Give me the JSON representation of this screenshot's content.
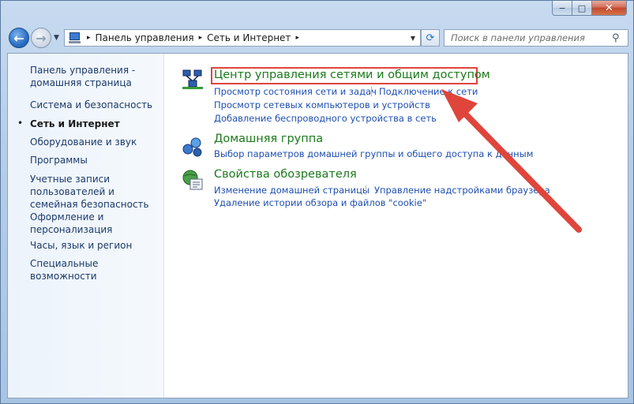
{
  "window": {
    "caption": {
      "minimize": "−",
      "maximize": "□",
      "close": "✕"
    }
  },
  "nav": {
    "back_icon": "←",
    "forward_icon": "→",
    "recent_icon": "▼",
    "breadcrumb": [
      "Панель управления",
      "Сеть и Интернет"
    ],
    "breadcrumb_sep": "▸",
    "dropdown_icon": "▼",
    "refresh_icon": "⟳",
    "search_placeholder": "Поиск в панели управления",
    "search_icon": "⚲"
  },
  "sidebar": {
    "items": [
      {
        "label": "Панель управления - домашняя страница"
      },
      {
        "label": "Система и безопасность"
      },
      {
        "label": "Сеть и Интернет",
        "active": true
      },
      {
        "label": "Оборудование и звук"
      },
      {
        "label": "Программы"
      },
      {
        "label": "Учетные записи пользователей и семейная безопасность"
      },
      {
        "label": "Оформление и персонализация"
      },
      {
        "label": "Часы, язык и регион"
      },
      {
        "label": "Специальные возможности"
      }
    ],
    "bullet": "•"
  },
  "categories": [
    {
      "title": "Центр управления сетями и общим доступом",
      "icon": "network-center-icon",
      "links": [
        "Просмотр состояния сети и задач",
        "Подключение к сети",
        "Просмотр сетевых компьютеров и устройств",
        "Добавление беспроводного устройства в сеть"
      ],
      "highlighted": true
    },
    {
      "title": "Домашняя группа",
      "icon": "homegroup-icon",
      "links": [
        "Выбор параметров домашней группы и общего доступа к данным"
      ]
    },
    {
      "title": "Свойства обозревателя",
      "icon": "internet-options-icon",
      "links": [
        "Изменение домашней страницы",
        "Управление надстройками браузера",
        "Удаление истории обзора и файлов \"cookie\""
      ]
    }
  ],
  "colors": {
    "category_title": "#1b7a1b",
    "link": "#1e4fb0",
    "highlight": "#e0453c",
    "annotation_arrow": "#e0453c"
  }
}
